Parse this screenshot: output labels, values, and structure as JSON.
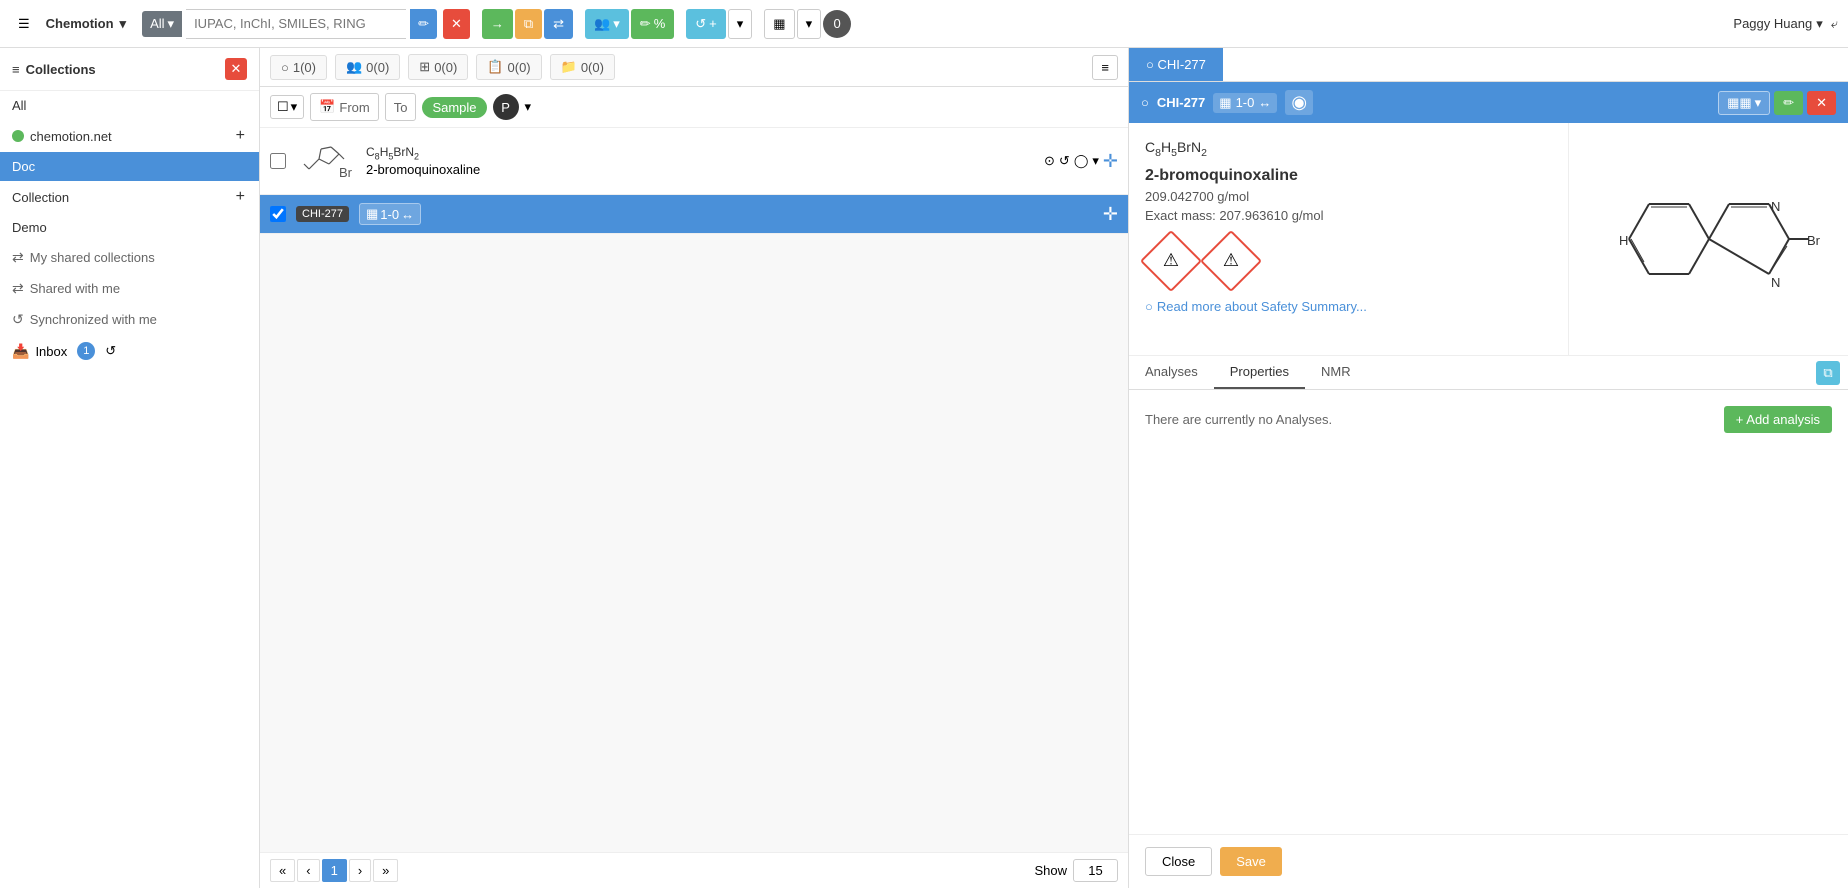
{
  "app": {
    "title": "Chemotion",
    "search_placeholder": "IUPAC, InChI, SMILES, RING",
    "search_all_label": "All",
    "user_name": "Paggy Huang"
  },
  "sidebar": {
    "title": "Collections",
    "all_label": "All",
    "chemotion_label": "chemotion.net",
    "doc_label": "Doc",
    "collection_label": "Collection",
    "demo_label": "Demo",
    "my_shared_label": "My shared collections",
    "shared_with_label": "Shared with me",
    "synced_label": "Synchronized with me",
    "inbox_label": "Inbox",
    "inbox_count": "1"
  },
  "filter": {
    "samples_count": "1(0)",
    "reactions_count": "0(0)",
    "wellplates_count": "0(0)",
    "screens_count": "0(0)",
    "research_count": "0(0)",
    "from_label": "From",
    "to_label": "To",
    "sample_label": "Sample"
  },
  "sample": {
    "formula_top": "C",
    "formula_subs": [
      "8",
      "H",
      "5",
      "Br",
      "N",
      "2"
    ],
    "formula_display": "C₈H₅BrN₂",
    "name": "2-bromoquinoxaline",
    "id": "CHI-277",
    "badge_text": "1-0",
    "arrow": "↔"
  },
  "detail": {
    "tab_label": "CHI-277",
    "header_id": "CHI-277",
    "header_badge": "1-0",
    "molecule_formula": "C₈H₅BrN₂",
    "molecule_name": "2-bromoquinoxaline",
    "molecular_weight": "209.042700 g/mol",
    "exact_mass_label": "Exact mass:",
    "exact_mass": "207.963610 g/mol",
    "safety_link": "Read more about Safety Summary...",
    "analyses_tab": "Analyses",
    "properties_tab": "Properties",
    "nmr_tab": "NMR",
    "no_analyses_text": "There are currently no Analyses.",
    "add_analysis_label": "+ Add analysis",
    "close_label": "Close",
    "save_label": "Save"
  },
  "pagination": {
    "current_page": "1",
    "show_label": "Show",
    "per_page": "15"
  },
  "icons": {
    "hamburger": "☰",
    "caret": "▾",
    "plus": "+",
    "share": "⇄",
    "sync": "⟳",
    "pencil": "✏",
    "times": "✕",
    "cog": "⚙",
    "users": "👥",
    "search": "🔍",
    "barcode": "▦",
    "lock": "🔒",
    "arrow_right": "→",
    "arrow_down": "↓",
    "list": "≡",
    "calendar": "📅",
    "chevron": "▾",
    "crosshair": "✛",
    "circle": "○",
    "refresh": "↺",
    "copy": "⧉",
    "eye": "◉",
    "flask": "⚗"
  }
}
